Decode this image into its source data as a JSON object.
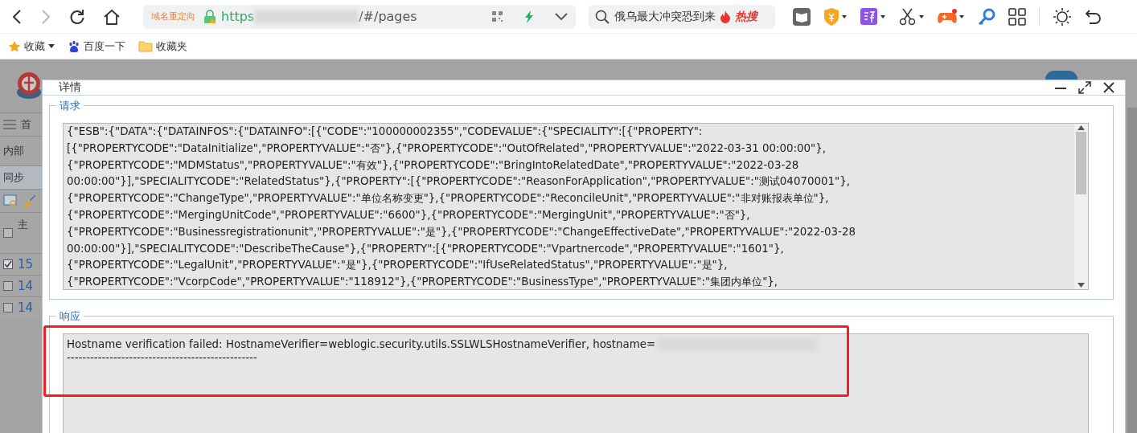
{
  "browser": {
    "address": {
      "badge": "域名重定向",
      "scheme": "https",
      "path": "/#/pages"
    },
    "search": {
      "text": "俄乌最大冲突恐到来",
      "hot": "热搜"
    },
    "bookmarks": [
      {
        "label": "收藏",
        "kind": "star"
      },
      {
        "label": "百度一下",
        "kind": "paw"
      },
      {
        "label": "收藏夹",
        "kind": "folder"
      }
    ]
  },
  "background_app": {
    "menu_tab": "首",
    "filter_label": "内部",
    "tab": "同步",
    "column_header": "主",
    "header_checked": false,
    "rows": [
      {
        "id": "15",
        "checked": true
      },
      {
        "id": "14",
        "checked": false
      },
      {
        "id": "14",
        "checked": false
      }
    ]
  },
  "dialog": {
    "title": "详情",
    "request": {
      "legend": "请求",
      "lines": [
        "{\"ESB\":{\"DATA\":{\"DATAINFOS\":{\"DATAINFO\":[{\"CODE\":\"100000002355\",\"CODEVALUE\":{\"SPECIALITY\":[{\"PROPERTY\":",
        "[{\"PROPERTYCODE\":\"DataInitialize\",\"PROPERTYVALUE\":\"否\"},{\"PROPERTYCODE\":\"OutOfRelated\",\"PROPERTYVALUE\":\"2022-03-31 00:00:00\"},",
        "{\"PROPERTYCODE\":\"MDMStatus\",\"PROPERTYVALUE\":\"有效\"},{\"PROPERTYCODE\":\"BringIntoRelatedDate\",\"PROPERTYVALUE\":\"2022-03-28",
        "00:00:00\"}],\"SPECIALITYCODE\":\"RelatedStatus\"},{\"PROPERTY\":[{\"PROPERTYCODE\":\"ReasonForApplication\",\"PROPERTYVALUE\":\"测试04070001\"},",
        "{\"PROPERTYCODE\":\"ChangeType\",\"PROPERTYVALUE\":\"单位名称变更\"},{\"PROPERTYCODE\":\"ReconcileUnit\",\"PROPERTYVALUE\":\"非对账报表单位\"},",
        "{\"PROPERTYCODE\":\"MergingUnitCode\",\"PROPERTYVALUE\":\"6600\"},{\"PROPERTYCODE\":\"MergingUnit\",\"PROPERTYVALUE\":\"否\"},",
        "{\"PROPERTYCODE\":\"Businessregistrationunit\",\"PROPERTYVALUE\":\"是\"},{\"PROPERTYCODE\":\"ChangeEffectiveDate\",\"PROPERTYVALUE\":\"2022-03-28",
        "00:00:00\"}],\"SPECIALITYCODE\":\"DescribeTheCause\"},{\"PROPERTY\":[{\"PROPERTYCODE\":\"Vpartnercode\",\"PROPERTYVALUE\":\"1601\"},",
        "{\"PROPERTYCODE\":\"LegalUnit\",\"PROPERTYVALUE\":\"是\"},{\"PROPERTYCODE\":\"IfUseRelatedStatus\",\"PROPERTYVALUE\":\"是\"},",
        "{\"PROPERTYCODE\":\"VcorpCode\",\"PROPERTYVALUE\":\"118912\"},{\"PROPERTYCODE\":\"BusinessType\",\"PROPERTYVALUE\":\"集团内单位\"},"
      ]
    },
    "response": {
      "legend": "响应",
      "lines": [
        "Hostname verification failed: HostnameVerifier=weblogic.security.utils.SSLWLSHostnameVerifier, hostname=",
        "-------------------------------------------------"
      ]
    }
  }
}
